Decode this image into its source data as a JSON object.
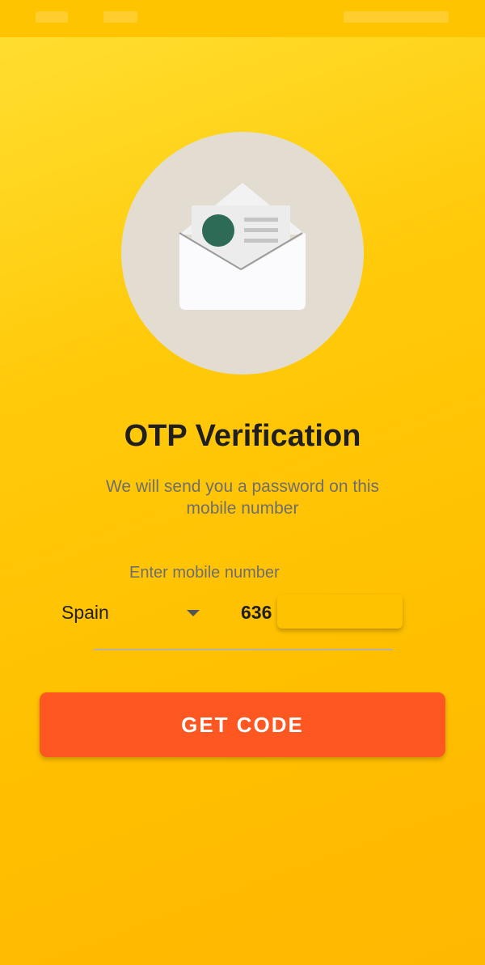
{
  "colors": {
    "background": "#FFC400",
    "primary_button": "#FF5722",
    "illustration_circle": "#E3DCD1",
    "title_text": "#1F1F1F",
    "secondary_text": "#6E6E6E"
  },
  "illustration": {
    "icon": "open-envelope-icon"
  },
  "header": {
    "title": "OTP Verification",
    "subtitle": "We will send you a password on this mobile number"
  },
  "form": {
    "label": "Enter mobile number",
    "country": "Spain",
    "country_dropdown_icon": "caret-down-icon",
    "phone_value": "636"
  },
  "actions": {
    "get_code_label": "GET CODE"
  }
}
